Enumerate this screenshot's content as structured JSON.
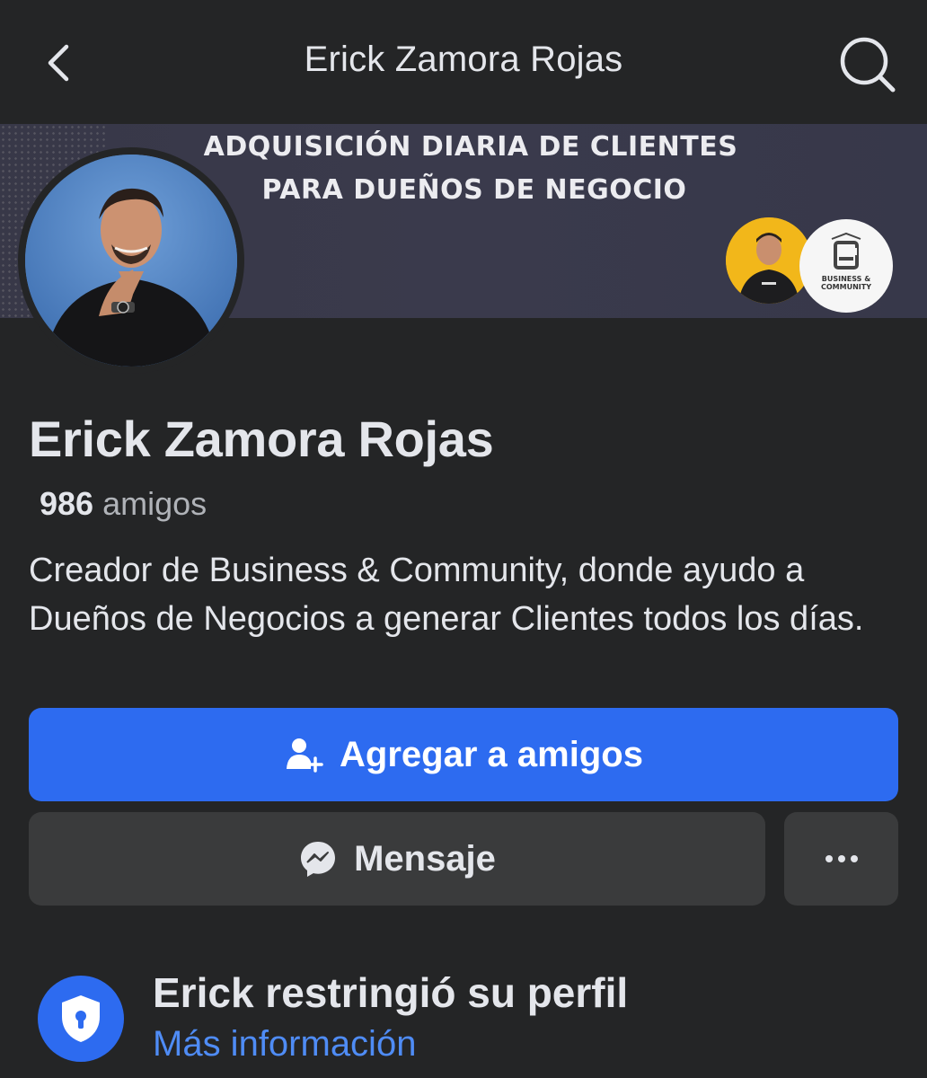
{
  "header": {
    "title": "Erick Zamora Rojas",
    "back_icon": "chevron-left-icon",
    "search_icon": "search-icon"
  },
  "cover": {
    "line1": "ADQUISICIÓN DIARIA DE CLIENTES",
    "line2": "PARA DUEÑOS DE NEGOCIO",
    "logo_text_1": "BUSINESS &",
    "logo_text_2": "COMMUNITY"
  },
  "profile": {
    "name": "Erick Zamora Rojas",
    "friends_count": "986",
    "friends_label": "amigos",
    "bio": "Creador de Business & Community, donde ayudo a Dueños de Negocios a generar Clientes todos los días."
  },
  "actions": {
    "add_friend_label": "Agregar a amigos",
    "add_friend_icon": "person-add-icon",
    "message_label": "Mensaje",
    "message_icon": "messenger-icon",
    "more_icon": "more-icon"
  },
  "restricted": {
    "title": "Erick restringió su perfil",
    "link": "Más información",
    "icon": "shield-lock-icon"
  },
  "colors": {
    "background": "#242526",
    "primary": "#2d6bf0",
    "secondary_button": "#3a3b3c",
    "link": "#4f8cf5",
    "text": "#e4e6eb",
    "muted_text": "#b0b3b8"
  }
}
